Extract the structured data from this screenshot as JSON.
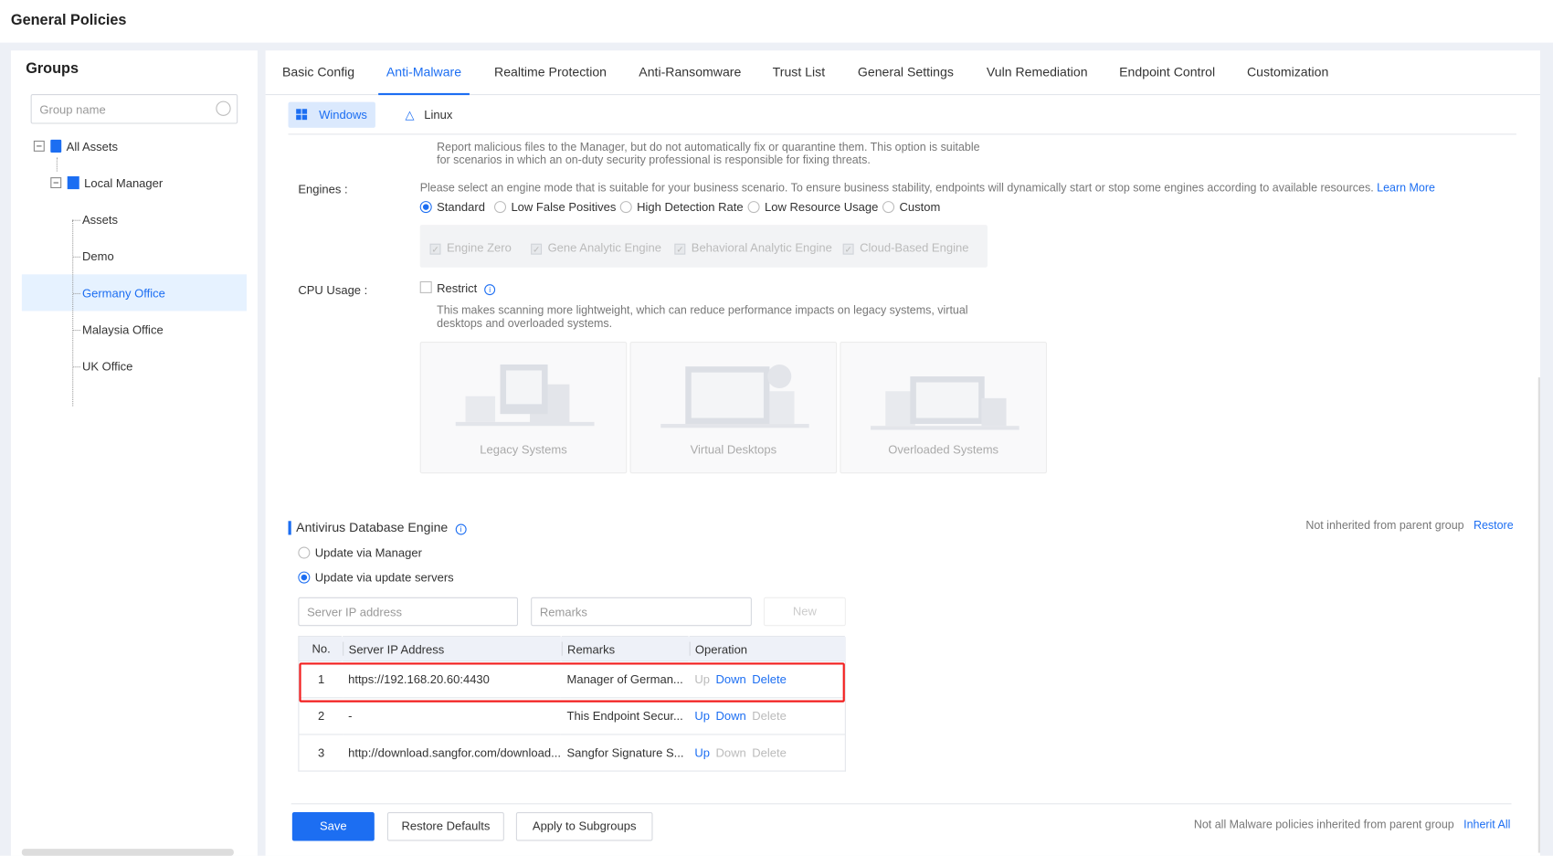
{
  "page_title": "General Policies",
  "sidebar": {
    "title": "Groups",
    "search_placeholder": "Group name",
    "tree": {
      "root": "All Assets",
      "manager": "Local Manager",
      "children": [
        "Assets",
        "Demo",
        "Germany Office",
        "Malaysia Office",
        "UK Office"
      ],
      "selected": "Germany Office"
    }
  },
  "tabs": [
    "Basic Config",
    "Anti-Malware",
    "Realtime Protection",
    "Anti-Ransomware",
    "Trust List",
    "General Settings",
    "Vuln Remediation",
    "Endpoint Control",
    "Customization"
  ],
  "active_tab": "Anti-Malware",
  "os_tabs": [
    "Windows",
    "Linux"
  ],
  "report_desc": "Report malicious files to the Manager, but do not automatically fix or quarantine them. This option is suitable for scenarios in which an on-duty security professional is responsible for fixing threats.",
  "engines": {
    "label": "Engines :",
    "desc": "Please select an engine mode that is suitable for your business scenario. To ensure business stability, endpoints will dynamically start or stop some engines according to available resources.",
    "learn_more": "Learn More",
    "modes": [
      "Standard",
      "Low False Positives",
      "High Detection Rate",
      "Low Resource Usage",
      "Custom"
    ],
    "selected": "Standard",
    "list": [
      "Engine Zero",
      "Gene Analytic Engine",
      "Behavioral Analytic Engine",
      "Cloud-Based Engine"
    ]
  },
  "cpu": {
    "label": "CPU Usage :",
    "restrict": "Restrict",
    "restrict_checked": false,
    "desc": "This makes scanning more lightweight, which can reduce performance impacts on legacy systems, virtual desktops and overloaded systems.",
    "cards": [
      "Legacy Systems",
      "Virtual Desktops",
      "Overloaded Systems"
    ]
  },
  "avdb": {
    "title": "Antivirus Database Engine",
    "inherit_status": "Not inherited from parent group",
    "restore": "Restore",
    "options": [
      "Update via Manager",
      "Update via update servers"
    ],
    "selected": "Update via update servers",
    "ip_placeholder": "Server IP address",
    "remarks_placeholder": "Remarks",
    "new": "New",
    "columns": [
      "No.",
      "Server IP Address",
      "Remarks",
      "Operation"
    ],
    "rows": [
      {
        "no": "1",
        "ip": "https://192.168.20.60:4430",
        "remarks": "Manager of German...",
        "up": "Up",
        "down": "Down",
        "delete": "Delete"
      },
      {
        "no": "2",
        "ip": "-",
        "remarks": "This Endpoint Secur...",
        "up": "Up",
        "down": "Down",
        "delete": "Delete"
      },
      {
        "no": "3",
        "ip": "http://download.sangfor.com/download...",
        "remarks": "Sangfor Signature S...",
        "up": "Up",
        "down": "Down",
        "delete": "Delete"
      }
    ]
  },
  "footer": {
    "save": "Save",
    "restore_defaults": "Restore Defaults",
    "apply": "Apply to Subgroups",
    "status": "Not all Malware policies inherited from parent group",
    "inherit_all": "Inherit All"
  },
  "colors": {
    "accent": "#1c6ef2",
    "highlight": "#f21e1e"
  }
}
